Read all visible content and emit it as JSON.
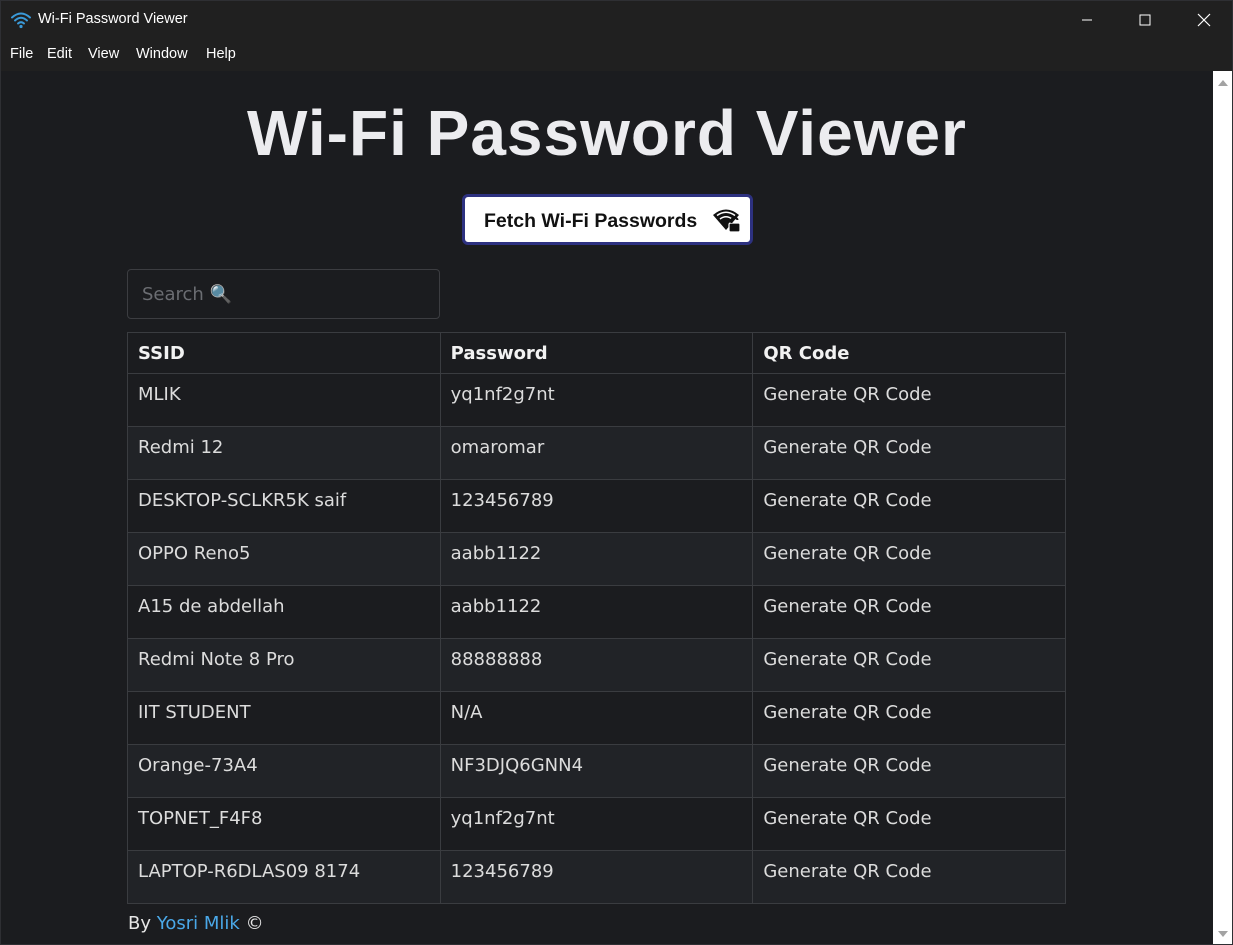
{
  "window": {
    "title": "Wi-Fi Password Viewer",
    "icon": "wifi-icon"
  },
  "menu": [
    "File",
    "Edit",
    "View",
    "Window",
    "Help"
  ],
  "page": {
    "title": "Wi-Fi Password Viewer",
    "fetch_button": "Fetch Wi-Fi Passwords",
    "fetch_icon": "wifi-unlock-icon",
    "search_placeholder": "Search 🔍"
  },
  "table": {
    "headers": [
      "SSID",
      "Password",
      "QR Code"
    ],
    "rows": [
      {
        "ssid": "MLIK",
        "password": "yq1nf2g7nt",
        "qr": "Generate QR Code"
      },
      {
        "ssid": "Redmi 12",
        "password": "omaromar",
        "qr": "Generate QR Code"
      },
      {
        "ssid": "DESKTOP-SCLKR5K saif",
        "password": "123456789",
        "qr": "Generate QR Code"
      },
      {
        "ssid": "OPPO Reno5",
        "password": "aabb1122",
        "qr": "Generate QR Code"
      },
      {
        "ssid": "A15 de abdellah",
        "password": "aabb1122",
        "qr": "Generate QR Code"
      },
      {
        "ssid": "Redmi Note 8 Pro",
        "password": "88888888",
        "qr": "Generate QR Code"
      },
      {
        "ssid": "IIT STUDENT",
        "password": "N/A",
        "qr": "Generate QR Code"
      },
      {
        "ssid": "Orange-73A4",
        "password": "NF3DJQ6GNN4",
        "qr": "Generate QR Code"
      },
      {
        "ssid": "TOPNET_F4F8",
        "password": "yq1nf2g7nt",
        "qr": "Generate QR Code"
      },
      {
        "ssid": "LAPTOP-R6DLAS09 8174",
        "password": "123456789",
        "qr": "Generate QR Code"
      }
    ]
  },
  "footer": {
    "prefix": "By",
    "author": "Yosri Mlik",
    "suffix": "©"
  },
  "colors": {
    "background": "#1b1c1f",
    "titlebar": "#202020",
    "link": "#4aa8e8",
    "button_border": "#2d3180"
  }
}
